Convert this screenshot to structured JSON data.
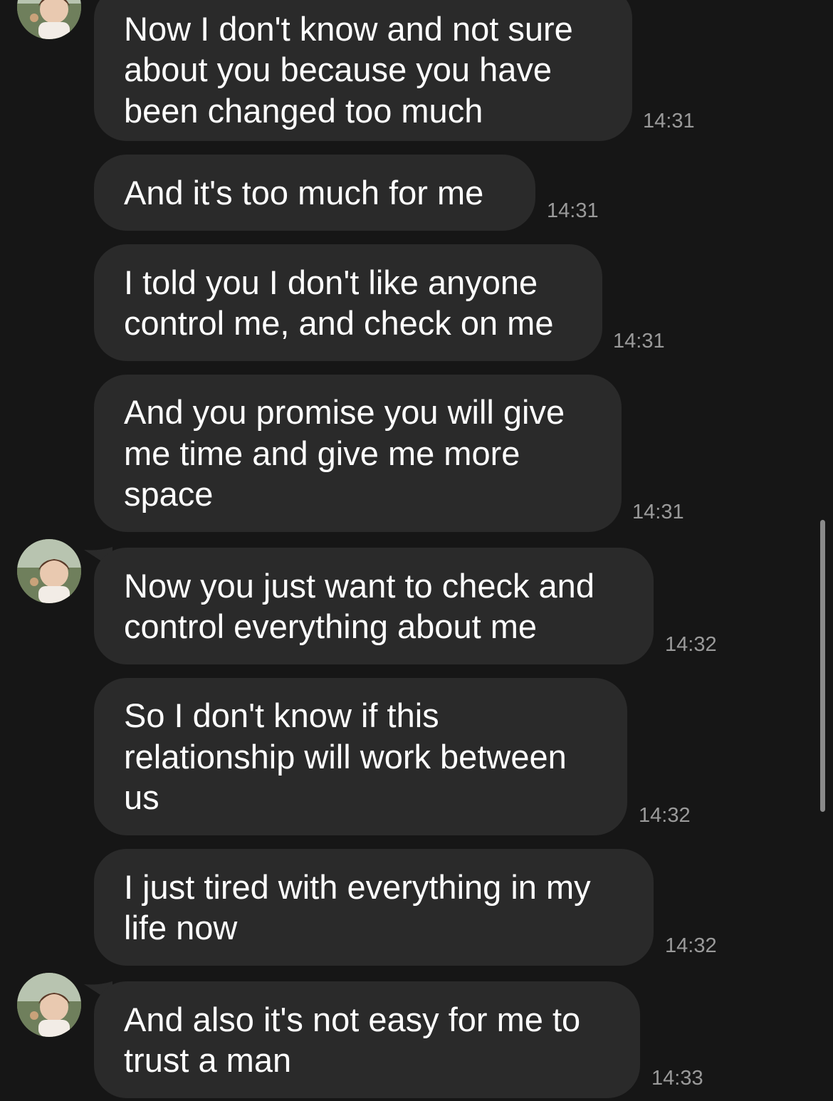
{
  "messages": [
    {
      "text": "Now I don't know and not sure\nabout you because you have\nbeen changed too much",
      "time": "14:31"
    },
    {
      "text": "And it's too much for me",
      "time": "14:31"
    },
    {
      "text": "I told you I don't like anyone\ncontrol me, and check on me",
      "time": "14:31"
    },
    {
      "text": "And you promise you will give\nme time and give me more\nspace",
      "time": "14:31"
    },
    {
      "text": "Now you just want to check and\ncontrol everything about me",
      "time": "14:32"
    },
    {
      "text": "So I don't know if this\nrelationship will work between\nus",
      "time": "14:32"
    },
    {
      "text": "I just tired with everything in my\nlife now",
      "time": "14:32"
    },
    {
      "text": "And also it's not easy for me to\ntrust a man",
      "time": "14:33"
    }
  ],
  "colors": {
    "background": "#161616",
    "bubble": "#2a2a2a",
    "text": "#ffffff",
    "timestamp": "#9a9a9a"
  },
  "icons": {
    "contact_avatar": "avatar-photo"
  }
}
